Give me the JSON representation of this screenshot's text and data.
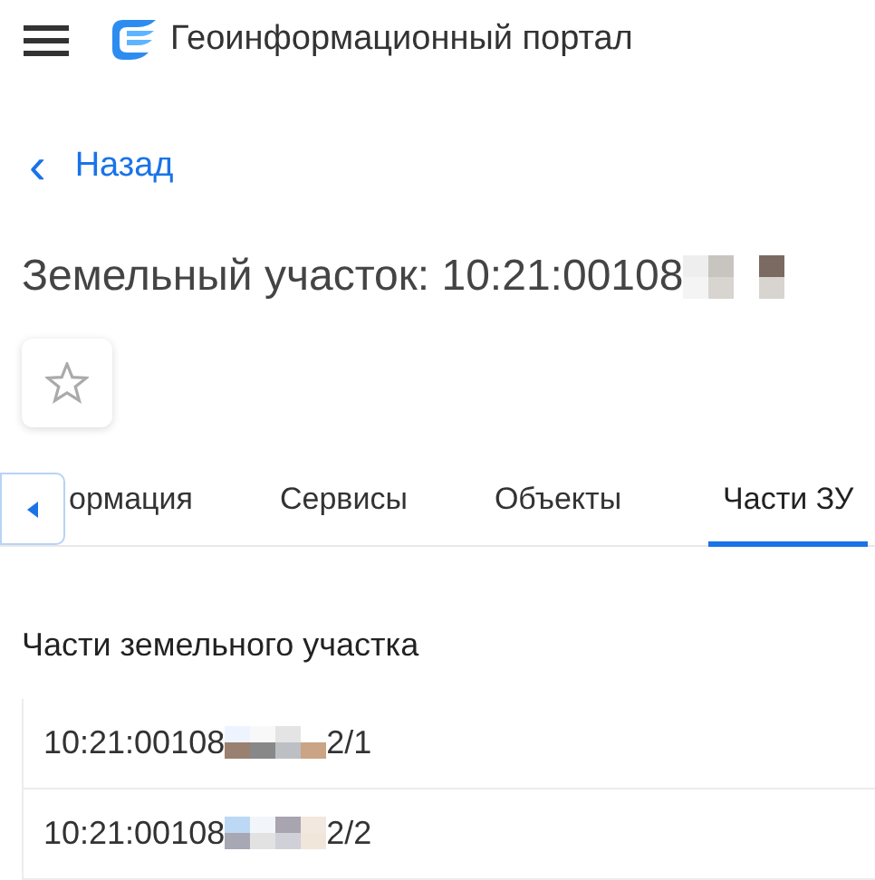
{
  "header": {
    "title": "Геоинформационный портал"
  },
  "back_link": {
    "icon": "‹",
    "label": "Назад"
  },
  "page_title": {
    "text": "Земельный участок: 10:21:00108",
    "redacted": true
  },
  "favorite": {
    "on": false
  },
  "tabs": [
    {
      "label": "ормация",
      "selected": false
    },
    {
      "label": "Сервисы",
      "selected": false
    },
    {
      "label": "Объекты",
      "selected": false
    },
    {
      "label": "Части ЗУ",
      "selected": true
    }
  ],
  "section": {
    "title": "Части земельного участка"
  },
  "parts": [
    {
      "prefix": "10:21:00108",
      "suffix": "2/1"
    },
    {
      "prefix": "10:21:00108",
      "suffix": "2/2"
    }
  ]
}
